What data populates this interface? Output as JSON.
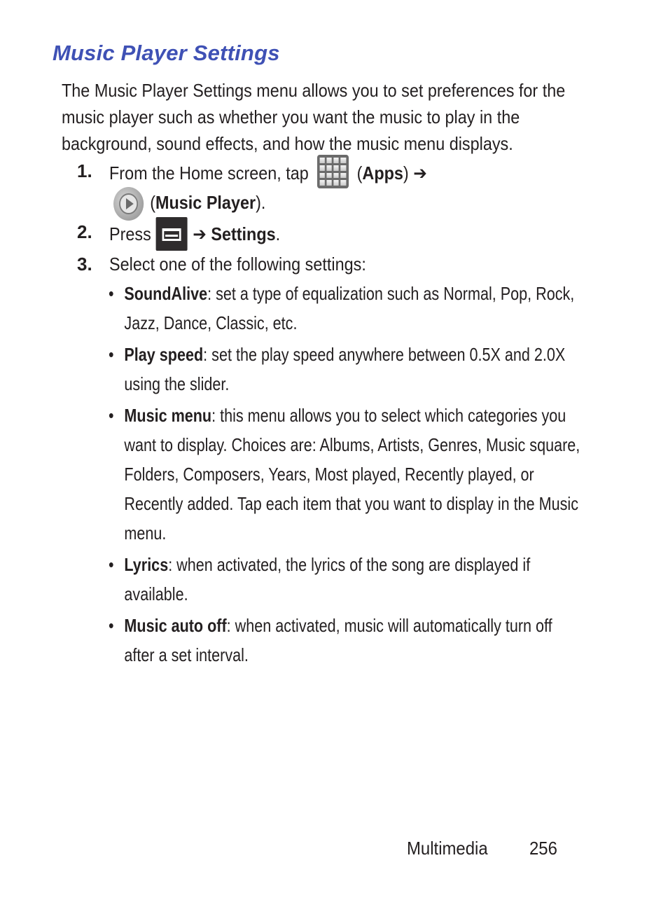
{
  "page": {
    "title": "Music Player Settings",
    "intro": "The Music Player Settings menu allows you to set preferences for the music player such as whether you want the music to play in the background, sound effects, and how the music menu displays.",
    "steps": [
      {
        "number": "1.",
        "text_before": "From the Home screen, tap",
        "apps_paren_open": " (",
        "apps_label": "Apps",
        "apps_paren_close": ") ",
        "arrow": "➔",
        "music_paren_open": "(",
        "music_label": "Music Player",
        "music_paren_close": ")."
      },
      {
        "number": "2.",
        "text_before": "Press",
        "arrow": "➔",
        "settings_label": "Settings",
        "period": "."
      },
      {
        "number": "3.",
        "text": "Select one of the following settings:"
      }
    ],
    "settings": [
      {
        "name": "SoundAlive",
        "description": ": set a type of equalization such as Normal, Pop, Rock, Jazz, Dance, Classic, etc."
      },
      {
        "name": "Play speed",
        "description": ": set the play speed anywhere between 0.5X and 2.0X using the slider."
      },
      {
        "name": "Music menu",
        "description": ": this menu allows you to select which categories you want to display. Choices are: Albums, Artists, Genres, Music square, Folders, Composers, Years, Most played, Recently played, or Recently added. Tap each item that you want to display in the Music menu."
      },
      {
        "name": "Lyrics",
        "description": ": when activated, the lyrics of the song are displayed if available."
      },
      {
        "name": "Music auto off",
        "description": ": when activated, music will automatically turn off after a set interval."
      }
    ],
    "bullet_glyph": "•",
    "footer": {
      "section": "Multimedia",
      "page_number": "256"
    },
    "icons": {
      "apps": "apps-grid-icon",
      "music_player": "music-player-icon",
      "menu": "menu-key-icon"
    },
    "colors": {
      "title": "#3f51b5",
      "text": "#231f20"
    }
  }
}
